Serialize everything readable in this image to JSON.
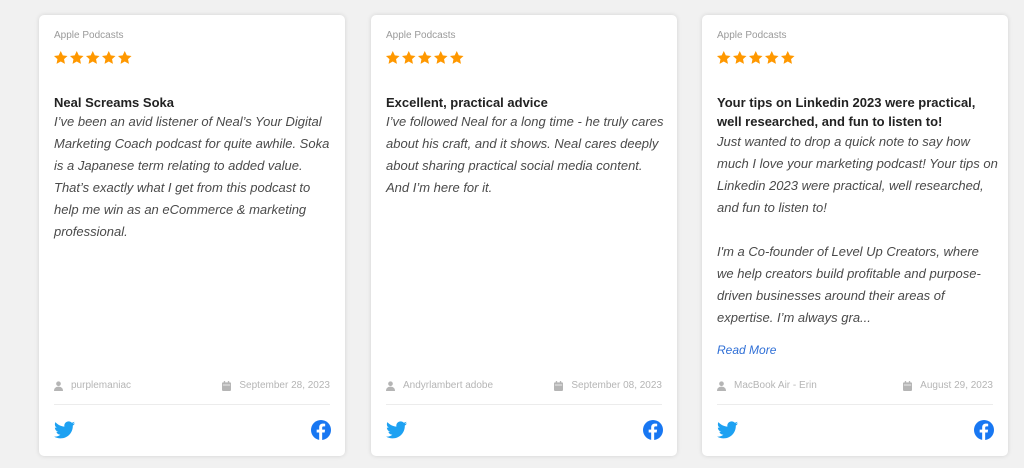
{
  "colors": {
    "star": "#ff9800",
    "twitter": "#1da1f2",
    "facebook": "#1877f2",
    "link": "#2f6fd6"
  },
  "reviews": [
    {
      "source": "Apple Podcasts",
      "rating": 5,
      "title": "Neal Screams Soka",
      "body": "I’ve been an avid listener of Neal’s Your Digital Marketing Coach podcast for quite awhile. Soka is a Japanese term relating to added value. That’s exactly what I get from this podcast to help me win as an eCommerce & marketing professional.",
      "author": "purplemaniac",
      "date": "September 28, 2023"
    },
    {
      "source": "Apple Podcasts",
      "rating": 5,
      "title": "Excellent, practical advice",
      "body": "I’ve followed Neal for a long time - he truly cares about his craft, and it shows. Neal cares deeply about sharing practical social media content. And I’m here for it.",
      "author": "Andyrlambert adobe",
      "date": "September 08, 2023"
    },
    {
      "source": "Apple Podcasts",
      "rating": 5,
      "title": "Your tips on Linkedin 2023 were practical, well researched, and fun to listen to!",
      "body": "Just wanted to drop a quick note to say how much I love your marketing podcast! Your tips on Linkedin 2023 were practical, well researched, and fun to listen to!\n\nI'm a Co-founder of Level Up Creators, where we help creators build profitable and purpose-driven businesses around their areas of expertise. I’m always gra...",
      "read_more": "Read More",
      "author": "MacBook Air - Erin",
      "date": "August 29, 2023"
    }
  ]
}
